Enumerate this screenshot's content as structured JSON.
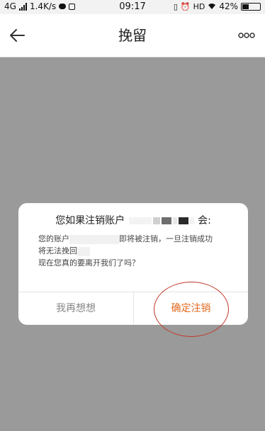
{
  "status_bar": {
    "network": "4G",
    "speed": "1.4K/s",
    "time": "09:17",
    "hd_label": "HD",
    "battery_text": "42%",
    "battery_level": 0.42
  },
  "header": {
    "title": "挽留",
    "back_icon": "arrow-left-icon",
    "more_icon": "more-dots-icon"
  },
  "dialog": {
    "title_prefix": "您如果注销账户",
    "title_suffix": "会:",
    "body_line1_prefix": "您的账户",
    "body_line1_suffix": "即将被注销，一旦注销成功",
    "body_line2_prefix": "将无法挽回",
    "body_line3": "现在您真的要离开我们了吗？",
    "cancel_label": "我再想想",
    "confirm_label": "确定注销"
  },
  "colors": {
    "accent": "#e06a1f",
    "overlay": "#9a9a9a",
    "annotation": "#c0392b"
  }
}
